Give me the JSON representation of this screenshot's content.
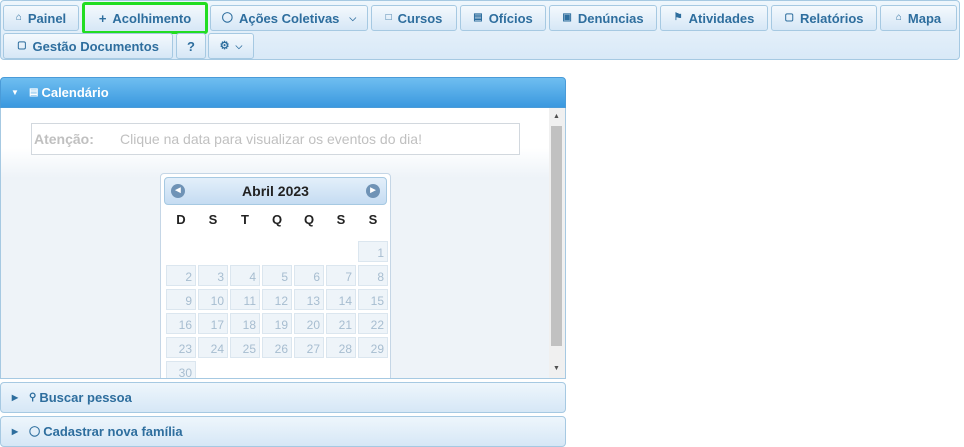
{
  "menu": {
    "painel": "Painel",
    "acolhimento": "Acolhimento",
    "acoes_coletivas": "Ações Coletivas",
    "cursos": "Cursos",
    "oficios": "Ofícios",
    "denuncias": "Denúncias",
    "atividades": "Atividades",
    "relatorios": "Relatórios",
    "mapa": "Mapa",
    "gestao_documentos": "Gestão Documentos",
    "help": "?"
  },
  "accordion": {
    "calendario": "Calendário",
    "buscar_pessoa": "Buscar pessoa",
    "cadastrar_familia": "Cadastrar nova família"
  },
  "notice": {
    "label": "Atenção:",
    "text": "Clique na data para visualizar os eventos do dia!"
  },
  "calendar": {
    "month": "Abril 2023",
    "weekdays": [
      "D",
      "S",
      "T",
      "Q",
      "Q",
      "S",
      "S"
    ],
    "days": [
      "1",
      "2",
      "3",
      "4",
      "5",
      "6",
      "7",
      "8",
      "9",
      "10",
      "11",
      "12",
      "13",
      "14",
      "15",
      "16",
      "17",
      "18",
      "19",
      "20",
      "21",
      "22",
      "23",
      "24",
      "25",
      "26",
      "27",
      "28",
      "29",
      "30"
    ]
  },
  "colors": {
    "accent": "#2e6e9e",
    "active_header": "#3a98df",
    "highlight": "#22dd22"
  }
}
